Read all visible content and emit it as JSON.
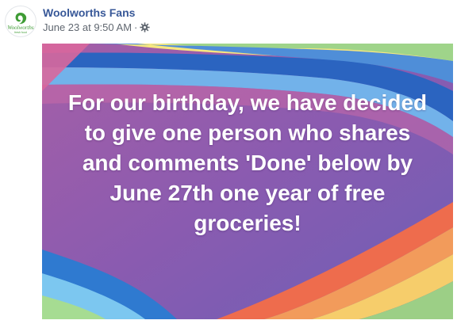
{
  "post": {
    "page_name": "Woolworths Fans",
    "timestamp": "June 23 at 9:50 AM",
    "separator": "·",
    "privacy_icon": "gear-icon",
    "avatar_logo": "woolworths-logo",
    "image_text": "For our birthday, we have decided to give one person who shares and comments 'Done' below by June 27th one year of free groceries!"
  },
  "colors": {
    "link": "#385898",
    "meta": "#606770",
    "woolworths_green": "#3f9c35"
  }
}
